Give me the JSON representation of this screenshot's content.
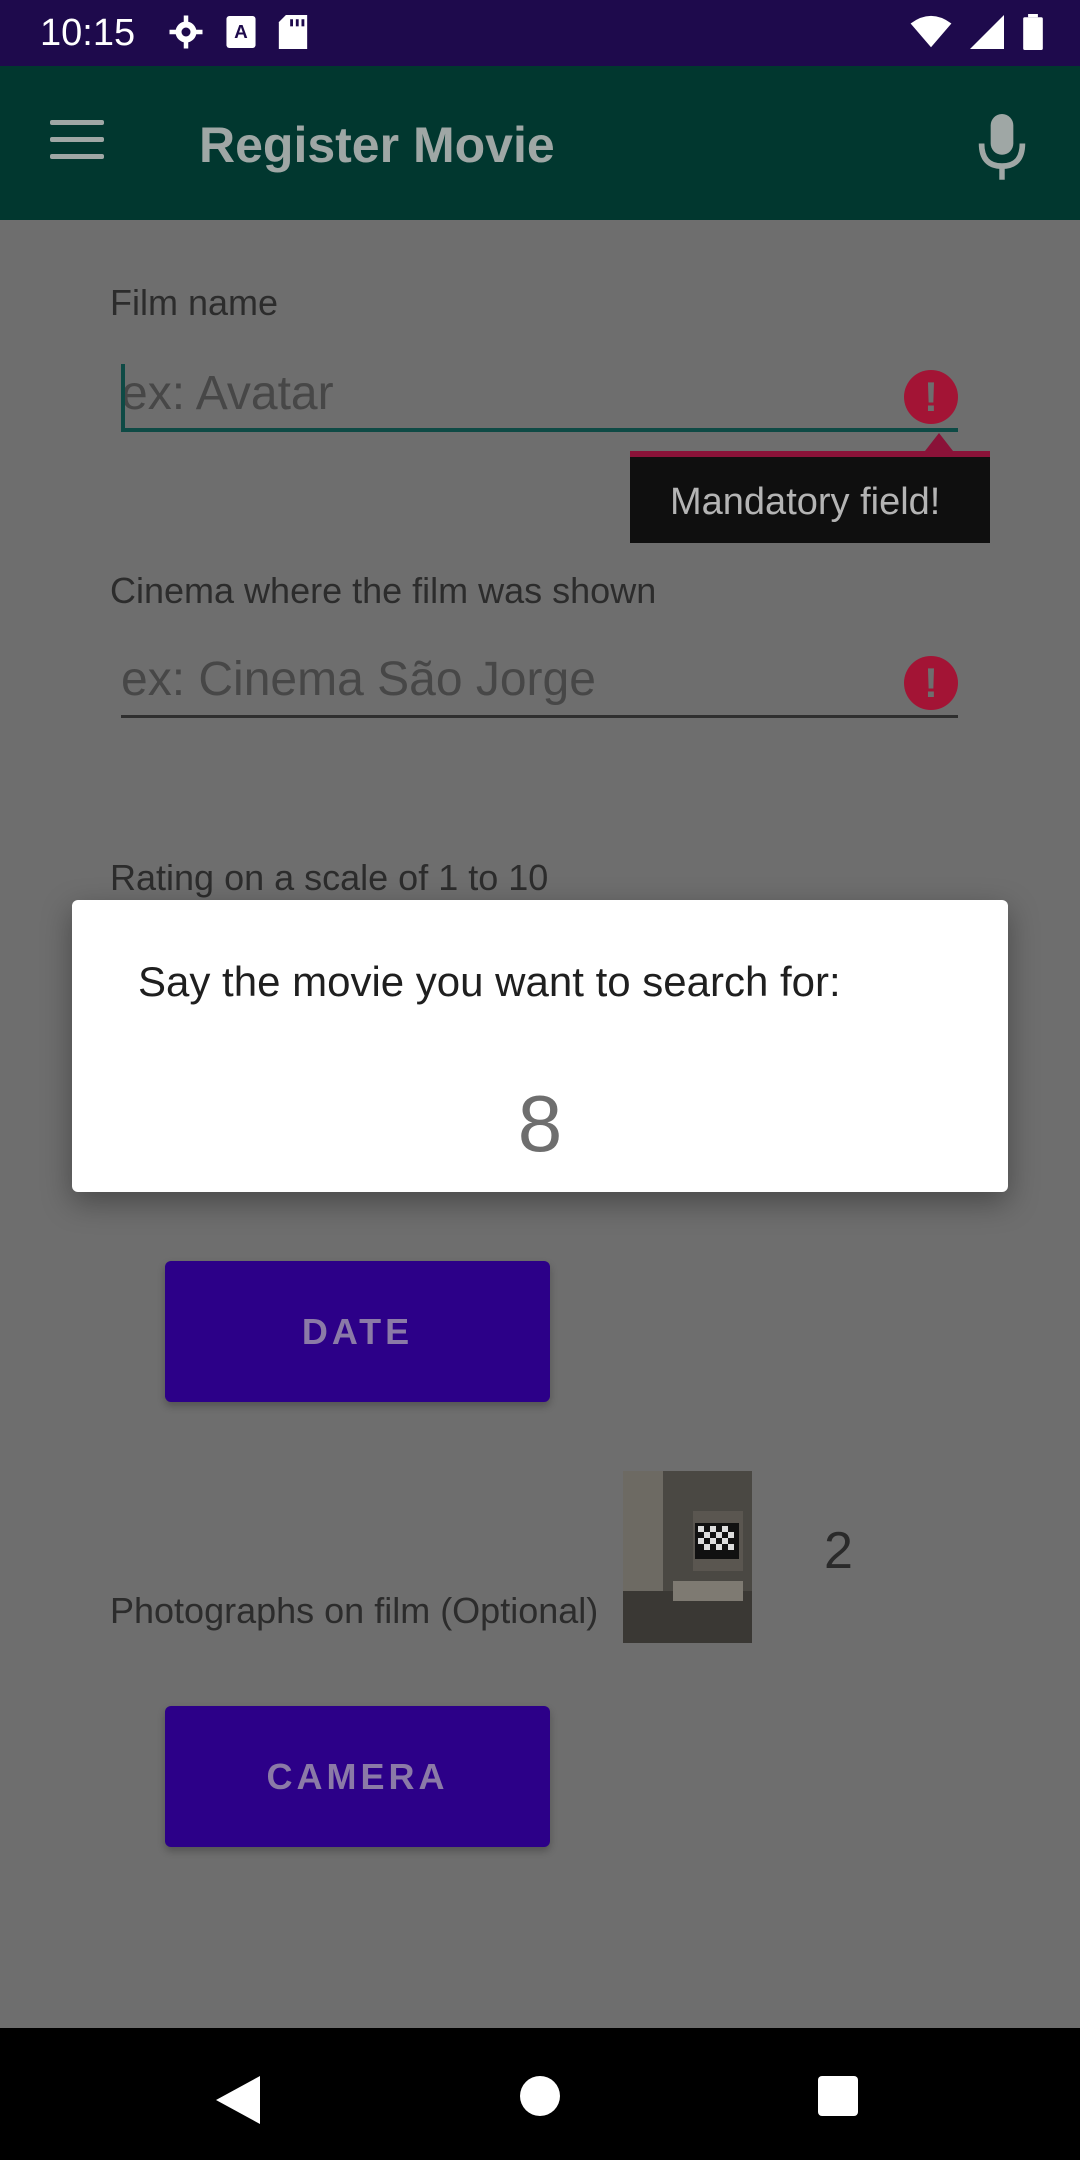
{
  "status_bar": {
    "time": "10:15",
    "icons_left": [
      "settings-icon",
      "text-a-icon",
      "sd-card-icon"
    ],
    "icons_right": [
      "wifi-icon",
      "signal-icon",
      "battery-icon"
    ]
  },
  "app_bar": {
    "title": "Register Movie",
    "menu_icon": "menu-icon",
    "action_icon": "mic-icon"
  },
  "form": {
    "film_name": {
      "label": "Film name",
      "placeholder": "ex: Avatar",
      "error_tooltip": "Mandatory field!"
    },
    "cinema": {
      "label": "Cinema where the film was shown",
      "placeholder": "ex: Cinema São Jorge"
    },
    "rating": {
      "label": "Rating on a scale of 1 to 10"
    },
    "date_button": "DATE",
    "photos": {
      "label": "Photographs on film (Optional)",
      "camera_button": "CAMERA",
      "count": "2"
    }
  },
  "dialog": {
    "title": "Say the movie you want to search for:",
    "value": "8"
  },
  "colors": {
    "status_bar": "#1e0a4c",
    "app_bar": "#01372f",
    "scrim": "#6e6e6e",
    "button": "#2c0088",
    "error": "#a31435"
  }
}
